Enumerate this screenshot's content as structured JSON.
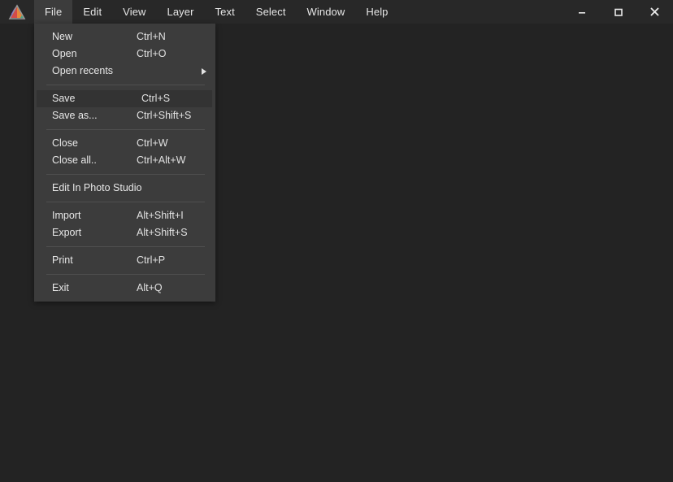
{
  "app": {
    "logo_icon": "affinity-photo-triangle-logo",
    "logo_colors": [
      "#8b6ad1",
      "#e8873c",
      "#d44a4a",
      "#3fa98a"
    ]
  },
  "colors": {
    "window_bg": "#232323",
    "menubar_bg": "#282828",
    "menu_panel_bg": "#3c3c3c",
    "menu_highlight_bg": "#333333",
    "menu_separator": "#4f4f4f",
    "text": "#e8e8e8"
  },
  "menubar": {
    "items": [
      {
        "label": "File",
        "active": true
      },
      {
        "label": "Edit",
        "active": false
      },
      {
        "label": "View",
        "active": false
      },
      {
        "label": "Layer",
        "active": false
      },
      {
        "label": "Text",
        "active": false
      },
      {
        "label": "Select",
        "active": false
      },
      {
        "label": "Window",
        "active": false
      },
      {
        "label": "Help",
        "active": false
      }
    ],
    "window_controls": [
      {
        "name": "minimize-button",
        "icon": "minimize-icon"
      },
      {
        "name": "maximize-button",
        "icon": "maximize-icon"
      },
      {
        "name": "close-button",
        "icon": "close-icon"
      }
    ]
  },
  "file_menu": {
    "open": true,
    "groups": [
      {
        "items": [
          {
            "label": "New",
            "shortcut": "Ctrl+N",
            "submenu": false,
            "highlight": false
          },
          {
            "label": "Open",
            "shortcut": "Ctrl+O",
            "submenu": false,
            "highlight": false
          },
          {
            "label": "Open recents",
            "shortcut": "",
            "submenu": true,
            "highlight": false
          }
        ]
      },
      {
        "items": [
          {
            "label": "Save",
            "shortcut": "Ctrl+S",
            "submenu": false,
            "highlight": true
          },
          {
            "label": "Save as...",
            "shortcut": "Ctrl+Shift+S",
            "submenu": false,
            "highlight": false
          }
        ]
      },
      {
        "items": [
          {
            "label": "Close",
            "shortcut": "Ctrl+W",
            "submenu": false,
            "highlight": false
          },
          {
            "label": "Close all..",
            "shortcut": "Ctrl+Alt+W",
            "submenu": false,
            "highlight": false
          }
        ]
      },
      {
        "items": [
          {
            "label": "Edit In Photo Studio",
            "shortcut": "",
            "submenu": false,
            "highlight": false
          }
        ]
      },
      {
        "items": [
          {
            "label": "Import",
            "shortcut": "Alt+Shift+I",
            "submenu": false,
            "highlight": false
          },
          {
            "label": "Export",
            "shortcut": "Alt+Shift+S",
            "submenu": false,
            "highlight": false
          }
        ]
      },
      {
        "items": [
          {
            "label": "Print",
            "shortcut": "Ctrl+P",
            "submenu": false,
            "highlight": false
          }
        ]
      },
      {
        "items": [
          {
            "label": "Exit",
            "shortcut": "Alt+Q",
            "submenu": false,
            "highlight": false
          }
        ]
      }
    ]
  }
}
